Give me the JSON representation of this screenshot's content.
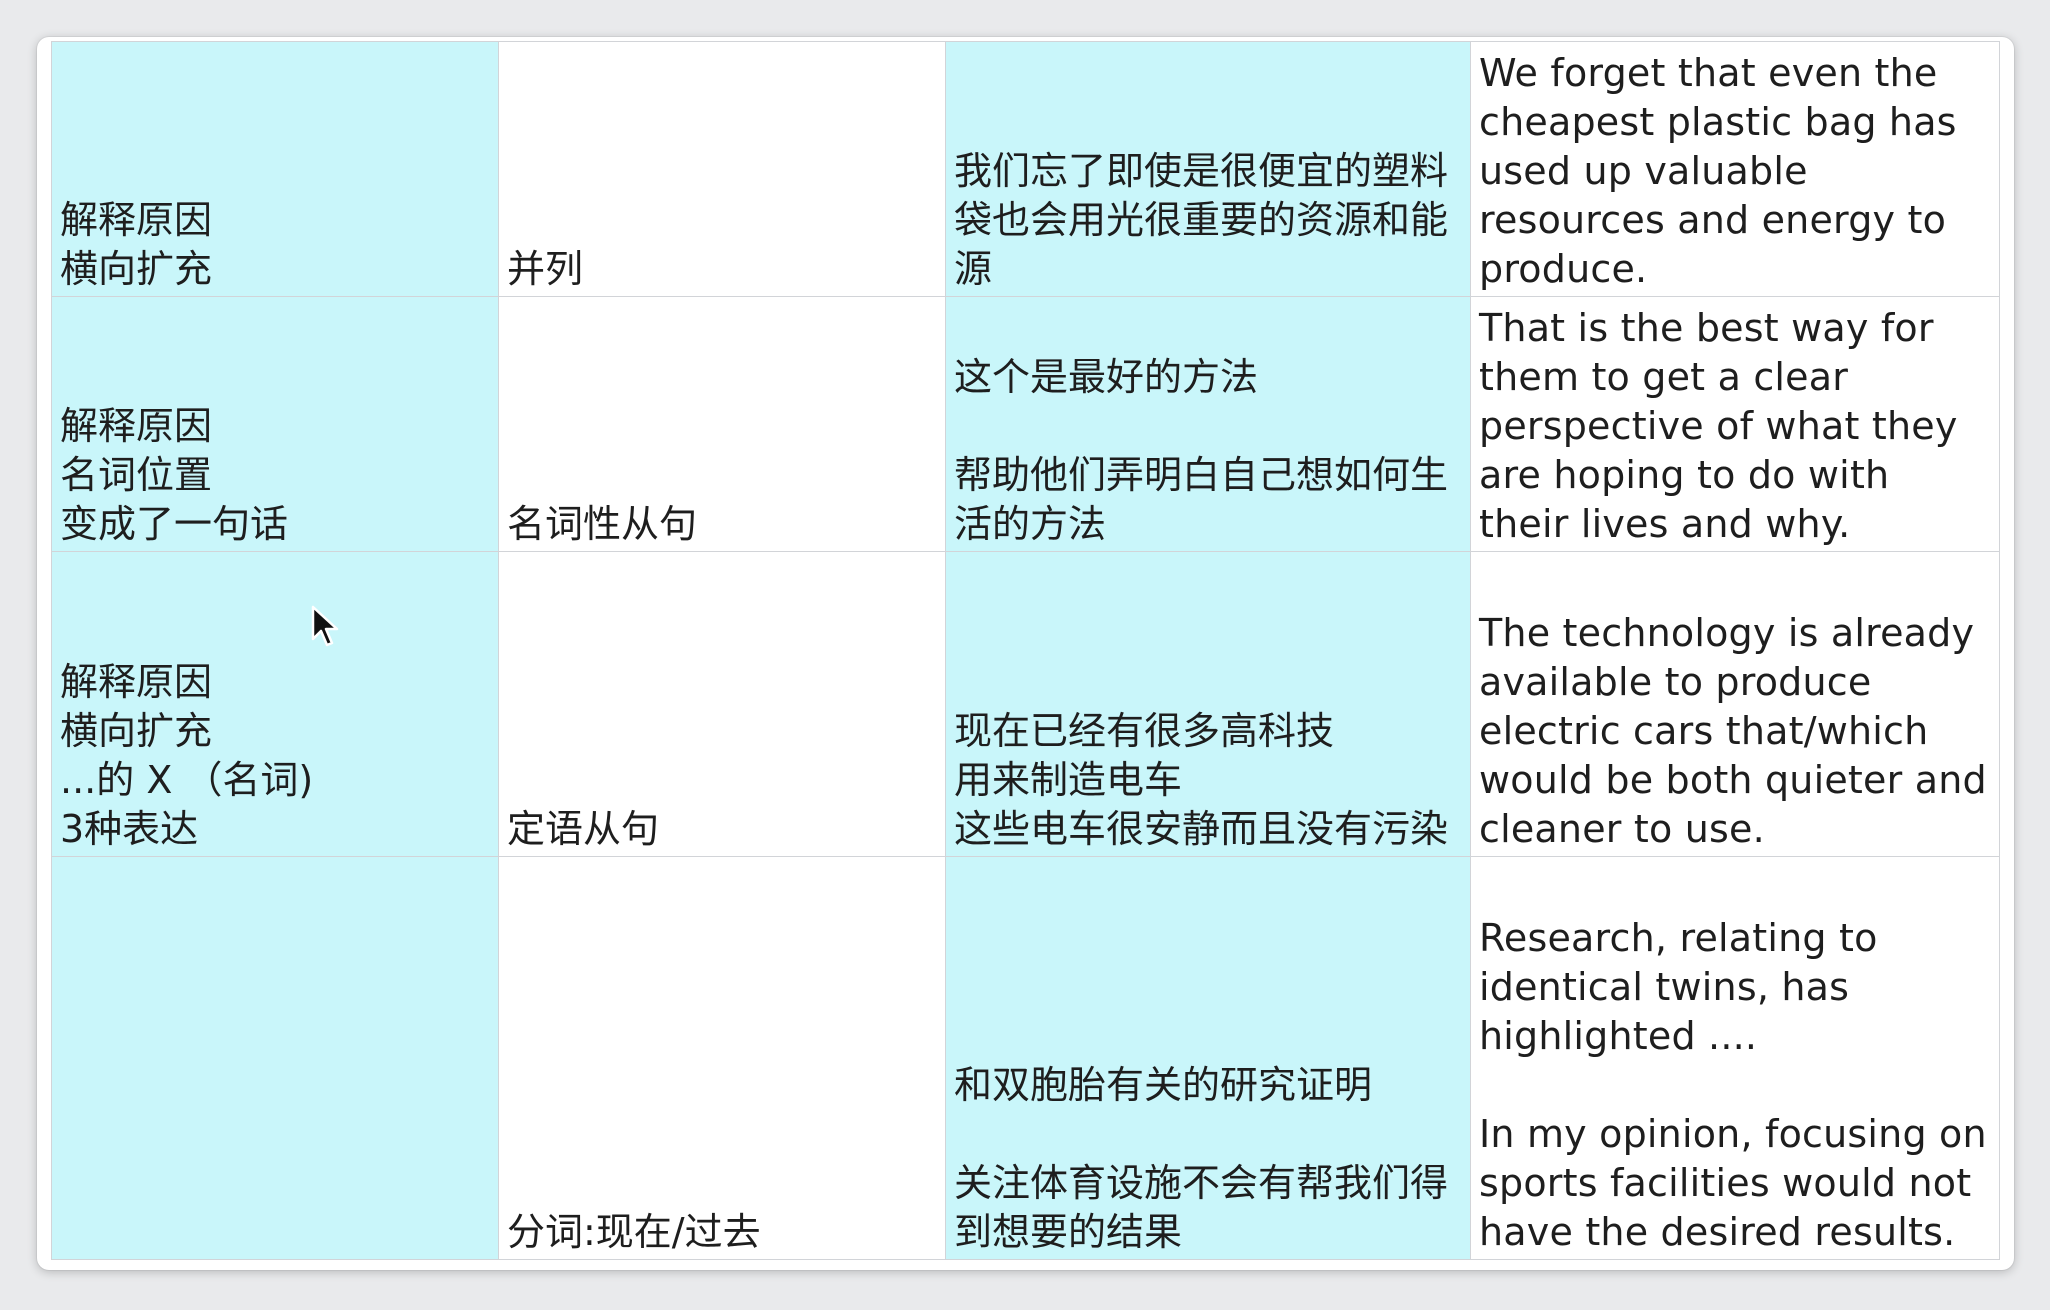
{
  "table": {
    "rows": [
      {
        "col1": "解释原因\n横向扩充",
        "col2": "并列",
        "col3": "我们忘了即使是很便宜的塑料袋也会用光很重要的资源和能源",
        "col4": "We forget that even the cheapest plastic bag has used up valuable resources and energy to produce."
      },
      {
        "col1": "解释原因\n名词位置\n变成了一句话",
        "col2": "名词性从句",
        "col3": "这个是最好的方法\n\n帮助他们弄明白自己想如何生活的方法",
        "col4": "That is the best way for them to get a clear perspective of what they are hoping to do with their lives and why."
      },
      {
        "col1": "解释原因\n横向扩充\n...的 X （名词)\n3种表达",
        "col2": "定语从句",
        "col3": "现在已经有很多高科技\n用来制造电车\n这些电车很安静而且没有污染",
        "col4": "The technology is already available to produce electric cars that/which would be both quieter and cleaner to use."
      },
      {
        "col1": "",
        "col2": "分词:现在/过去",
        "col3": "和双胞胎有关的研究证明\n\n关注体育设施不会有帮我们得到想要的结果",
        "col4": "Research, relating to identical twins, has highlighted ....\n\nIn my opinion, focusing on sports facilities would not have the desired results."
      }
    ]
  },
  "icons": {
    "cursor": "mouse-pointer-icon"
  },
  "colors": {
    "cyan_cell": "#c9f6fa",
    "white_cell": "#ffffff",
    "grid_line": "#d2d4d8",
    "text": "#1e1e1e"
  }
}
